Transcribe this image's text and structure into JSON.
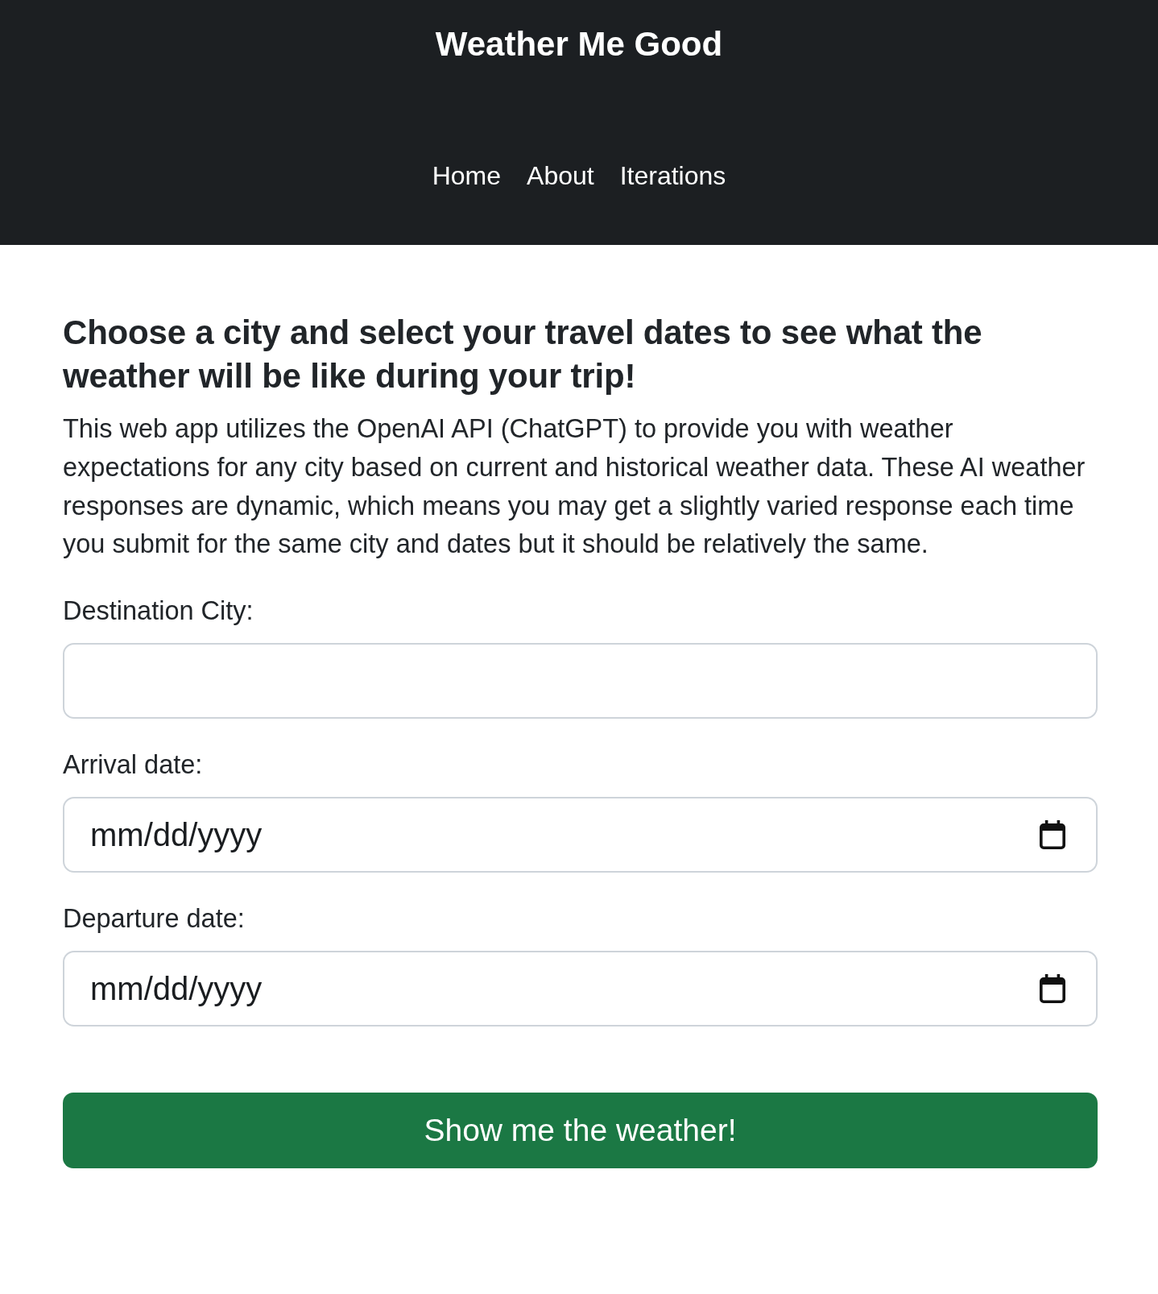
{
  "header": {
    "title": "Weather Me Good",
    "nav": [
      "Home",
      "About",
      "Iterations"
    ]
  },
  "intro": {
    "heading": "Choose a city and select your travel dates to see what the weather will be like during your trip!",
    "text": "This web app utilizes the OpenAI API (ChatGPT) to provide you with weather expectations for any city based on current and historical weather data. These AI weather responses are dynamic, which means you may get a slightly varied response each time you submit for the same city and dates but it should be relatively the same."
  },
  "form": {
    "fields": [
      {
        "kind": "text",
        "label": "Destination City:"
      },
      {
        "kind": "date",
        "label": "Arrival date:",
        "placeholder": "mm/dd/yyyy"
      },
      {
        "kind": "date",
        "label": "Departure date:",
        "placeholder": "mm/dd/yyyy"
      }
    ],
    "submit": "Show me the weather!"
  }
}
